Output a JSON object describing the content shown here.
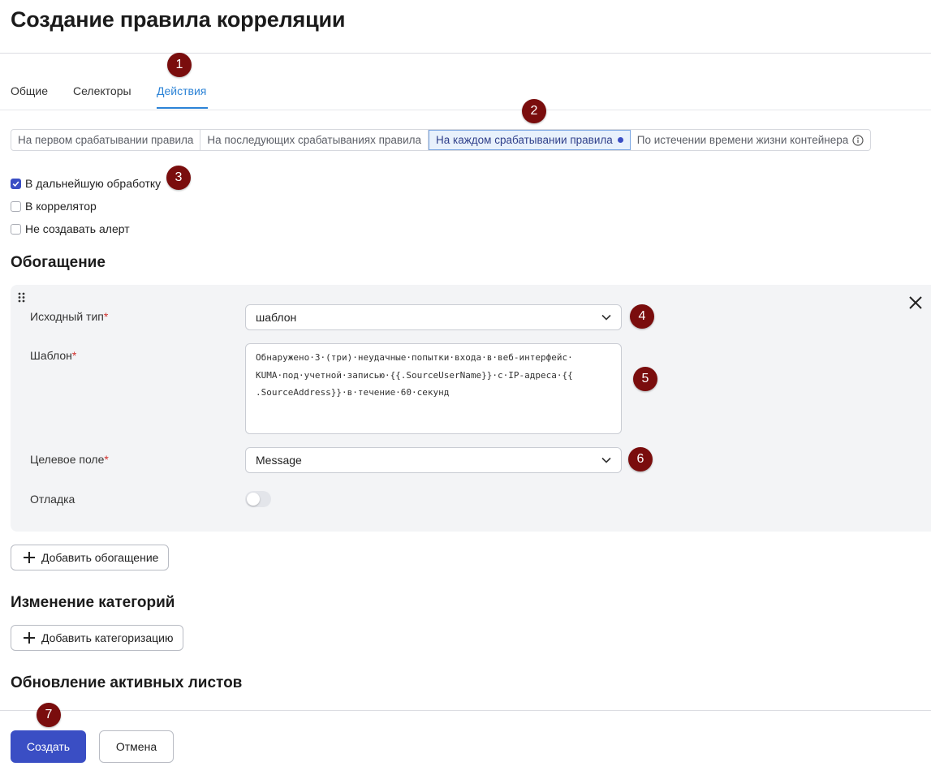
{
  "page": {
    "title": "Создание правила корреляции"
  },
  "tabs": [
    {
      "label": "Общие"
    },
    {
      "label": "Селекторы"
    },
    {
      "label": "Действия",
      "active": true
    }
  ],
  "trigger_modes": [
    {
      "label": "На первом срабатывании правила"
    },
    {
      "label": "На последующих срабатываниях правила"
    },
    {
      "label": "На каждом срабатывании правила",
      "active": true
    },
    {
      "label": "По истечении времени жизни контейнера"
    }
  ],
  "options": [
    {
      "label": "В дальнейшую обработку",
      "checked": true
    },
    {
      "label": "В коррелятор",
      "checked": false
    },
    {
      "label": "Не создавать алерт",
      "checked": false
    }
  ],
  "enrichment": {
    "title": "Обогащение",
    "source_type": {
      "label": "Исходный тип",
      "value": "шаблон"
    },
    "template": {
      "label": "Шаблон",
      "value": "Обнаружено·3·(три)·неудачные·попытки·входа·в·веб-интерфейс·\nKUMA·под·учетной·записью·{{.SourceUserName}}·с·IP-адреса·{{\n.SourceAddress}}·в·течение·60·секунд"
    },
    "target_field": {
      "label": "Целевое поле",
      "value": "Message"
    },
    "debug": {
      "label": "Отладка",
      "enabled": false
    },
    "add_button": "Добавить обогащение"
  },
  "categories": {
    "title": "Изменение категорий",
    "add_button": "Добавить категоризацию"
  },
  "active_lists": {
    "title": "Обновление активных листов"
  },
  "footer": {
    "create": "Создать",
    "cancel": "Отмена"
  },
  "markers": [
    "1",
    "2",
    "3",
    "4",
    "5",
    "6",
    "7"
  ],
  "colors": {
    "primary": "#3a4ec4",
    "tab_active": "#2c83d6",
    "marker": "#7a0d0d",
    "required": "#d0312d"
  }
}
